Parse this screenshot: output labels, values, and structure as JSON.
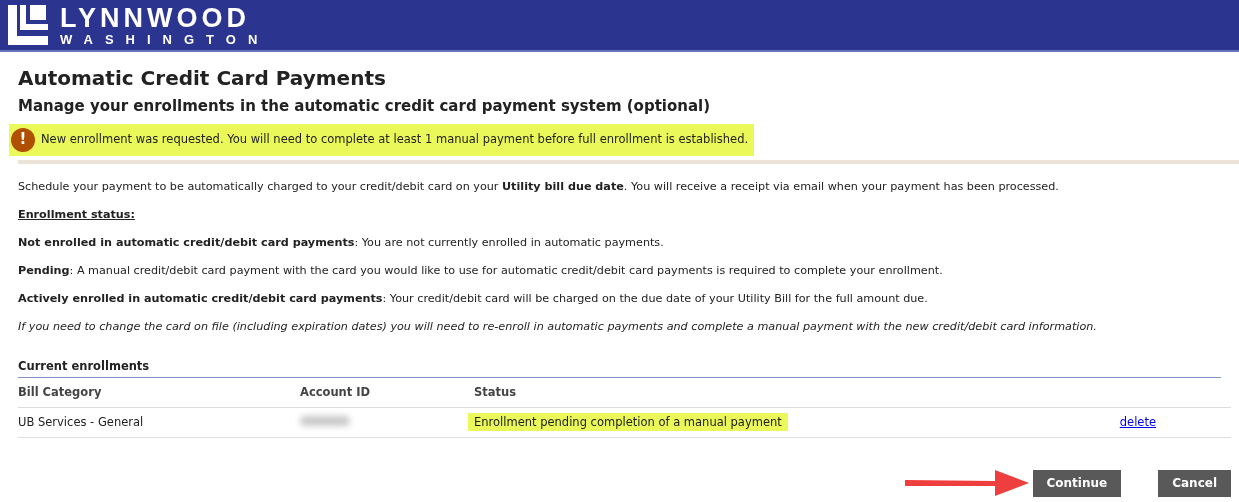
{
  "header": {
    "logo_name": "LYNNWOOD",
    "logo_sub": "WASHINGTON"
  },
  "title": "Automatic Credit Card Payments",
  "subtitle": "Manage your enrollments in the automatic credit card payment system (optional)",
  "alert": {
    "icon": "!",
    "text": "New enrollment was requested. You will need to complete at least 1 manual payment before full enrollment is established.",
    "highlighted": true
  },
  "paragraphs": [
    {
      "kind": "plain",
      "text": "Schedule your payment to be automatically charged to your credit/debit card on your **Utility bill due date**. You will receive a receipt via email when your payment has been processed."
    },
    {
      "kind": "heading",
      "text": "Enrollment status:"
    },
    {
      "kind": "plain",
      "text": "**Not enrolled in automatic credit/debit card payments**: You are not currently enrolled in automatic payments."
    },
    {
      "kind": "plain",
      "text": "**Pending**: A manual credit/debit card payment with the card you would like to use for automatic credit/debit card payments is required to complete your enrollment."
    },
    {
      "kind": "plain",
      "text": "**Actively enrolled in automatic credit/debit card payments**: Your credit/debit card will be charged on the due date of your Utility Bill for the full amount due."
    },
    {
      "kind": "note",
      "text": "If you need to change the card on file (including expiration dates) you will need to re-enroll in automatic payments and complete a manual payment with the new credit/debit card information."
    }
  ],
  "enrollments": {
    "title": "Current enrollments",
    "columns": [
      "Bill Category",
      "Account ID",
      "Status"
    ],
    "rows": [
      {
        "bill_category": "UB Services - General",
        "status": "Enrollment pending completion of a manual payment",
        "status_highlighted": true,
        "action": "delete"
      }
    ]
  },
  "buttons": [
    {
      "label": "Continue",
      "arrow": true
    },
    {
      "label": "Cancel",
      "arrow": false
    }
  ]
}
